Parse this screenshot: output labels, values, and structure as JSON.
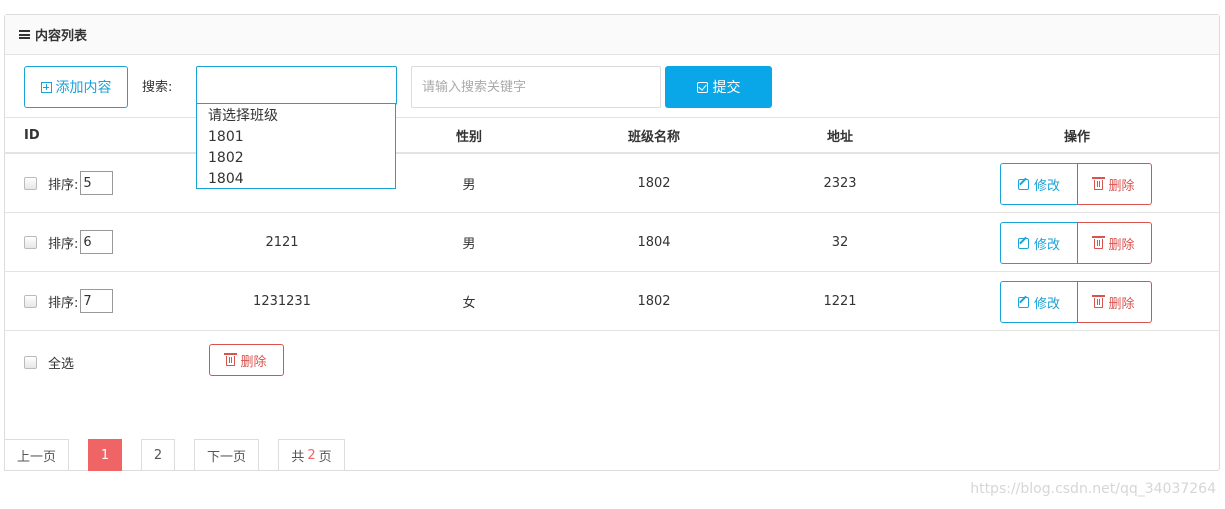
{
  "panel": {
    "title": "内容列表"
  },
  "toolbar": {
    "add_label": "添加内容",
    "search_label": "搜索:",
    "keyword_placeholder": "请输入搜索关键字",
    "submit_label": "提交"
  },
  "class_select": {
    "options": [
      "请选择班级",
      "1801",
      "1802",
      "1804"
    ]
  },
  "table": {
    "headers": {
      "id": "ID",
      "gender": "性别",
      "class_name": "班级名称",
      "address": "地址",
      "actions": "操作"
    },
    "sort_label": "排序:",
    "edit_label": "修改",
    "delete_label": "删除",
    "rows": [
      {
        "sort": "5",
        "name": "",
        "gender": "男",
        "class_name": "1802",
        "address": "2323"
      },
      {
        "sort": "6",
        "name": "2121",
        "gender": "男",
        "class_name": "1804",
        "address": "32"
      },
      {
        "sort": "7",
        "name": "1231231",
        "gender": "女",
        "class_name": "1802",
        "address": "1221"
      }
    ]
  },
  "footer": {
    "select_all_label": "全选",
    "delete_label": "删除"
  },
  "pagination": {
    "prev_label": "上一页",
    "pages": [
      "1",
      "2"
    ],
    "current_page": "1",
    "next_label": "下一页",
    "total_prefix": "共",
    "total_pages": "2",
    "total_suffix": "页"
  },
  "watermark": "https://blog.csdn.net/qq_34037264",
  "colors": {
    "primary": "#0aa7e8",
    "danger": "#d9534f",
    "active_page": "#ef6565"
  }
}
